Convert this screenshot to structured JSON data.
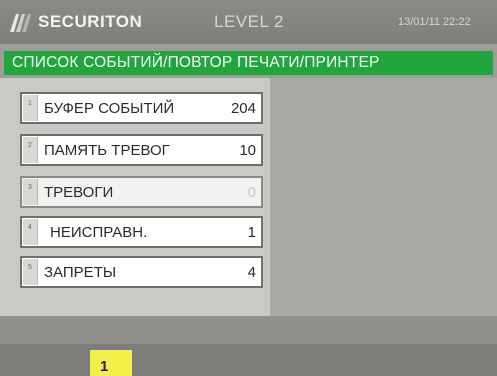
{
  "header": {
    "brand": "SECURITON",
    "level": "LEVEL 2",
    "datetime": "13/01/11 22:22"
  },
  "title": "СПИСОК СОБЫТИЙ/ПОВТОР ПЕЧАТИ/ПРИНТЕР",
  "menu": [
    {
      "key": "1",
      "label": "БУФЕР СОБЫТИЙ",
      "count": "204"
    },
    {
      "key": "2",
      "label": "ПАМЯТЬ ТРЕВОГ",
      "count": "10"
    },
    {
      "key": "3",
      "label": "ТРЕВОГИ",
      "count": "0"
    },
    {
      "key": "4",
      "label": "НЕИСПРАВН.",
      "count": "1"
    },
    {
      "key": "5",
      "label": "ЗАПРЕТЫ",
      "count": "4"
    }
  ],
  "footer": {
    "tab_label": "1"
  },
  "colors": {
    "title_bar": "#23a53e",
    "tab_highlight": "#f3f04a"
  }
}
